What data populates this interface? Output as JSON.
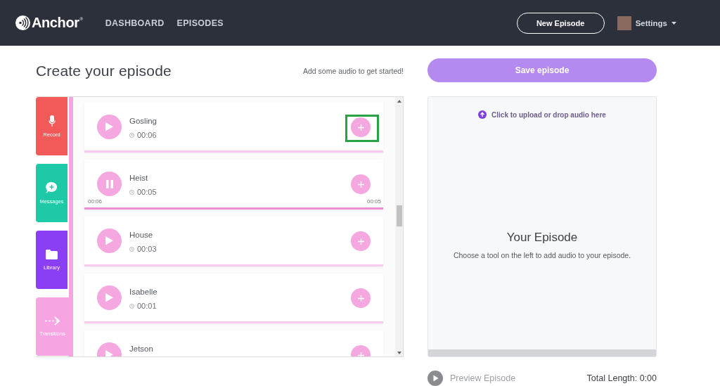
{
  "header": {
    "logo": "Anchor$^{®}$",
    "nav": [
      "DASHBOARD",
      "EPISODES"
    ],
    "new_episode_button": "New Episode",
    "account_menu": "Settings"
  },
  "editor": {
    "title": "Create your episode",
    "hint": "Add some audio to get started!",
    "tools": [
      {
        "label": "Record",
        "kind": "record",
        "color": "#f25a5a",
        "selected": false
      },
      {
        "label": "Messages",
        "kind": "messages",
        "color": "#1dc9a6",
        "selected": false
      },
      {
        "label": "Library",
        "kind": "library",
        "color": "#8a3ff5",
        "selected": false
      },
      {
        "label": "Transitions",
        "kind": "transitions",
        "color": "#f6a4e2",
        "selected": true
      }
    ],
    "audio_list": [
      {
        "title": "Gosling",
        "duration": "00:06",
        "playing": false,
        "highlighted": true
      },
      {
        "title": "Heist",
        "duration": "00:05",
        "playing": true,
        "highlighted": false,
        "elapsed": "00:06",
        "remaining": "00:05"
      },
      {
        "title": "House",
        "duration": "00:03",
        "playing": false,
        "highlighted": false
      },
      {
        "title": "Isabelle",
        "duration": "00:01",
        "playing": false,
        "highlighted": false
      },
      {
        "title": "Jetson",
        "playing": false,
        "highlighted": false
      }
    ]
  },
  "episode": {
    "save_button": {
      "label": "Save episode",
      "disabled": true
    },
    "upload_link": "Click to upload or drop audio here",
    "heading": "Your Episode",
    "description": "Choose a tool on the left to add audio to your episode.",
    "preview_button": {
      "label": "Preview Episode",
      "disabled": true
    },
    "total_length": "Total Length: 0:00"
  }
}
